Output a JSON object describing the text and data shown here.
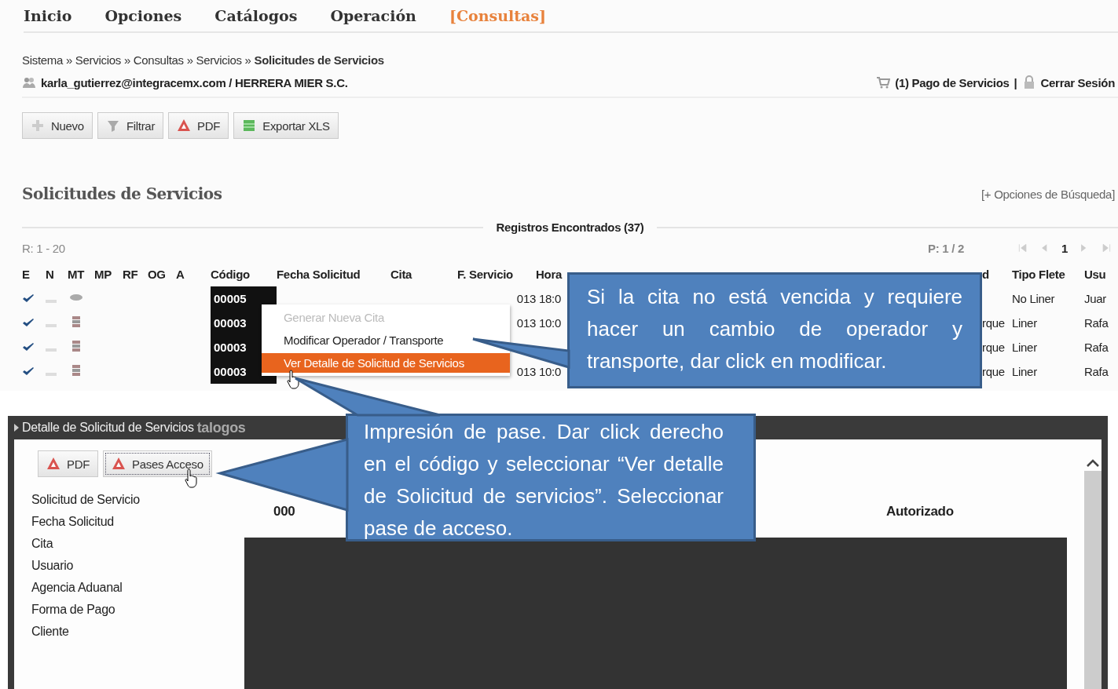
{
  "nav": [
    {
      "label": "Inicio",
      "selected": false
    },
    {
      "label": "Opciones",
      "selected": false
    },
    {
      "label": "Catálogos",
      "selected": false
    },
    {
      "label": "Operación",
      "selected": false
    },
    {
      "label": "[Consultas]",
      "selected": true
    }
  ],
  "breadcrumb": {
    "path": "Sistema » Servicios » Consultas » Servicios » ",
    "current": "Solicitudes de Servicios"
  },
  "user": "karla_gutierrez@integracemx.com / HERRERA MIER S.C.",
  "cart_link": "(1) Pago de Servicios",
  "separator": "|",
  "logout": "Cerrar Sesión",
  "toolbar": [
    {
      "kind": "new",
      "label": "Nuevo"
    },
    {
      "kind": "filter",
      "label": "Filtrar"
    },
    {
      "kind": "pdf",
      "label": "PDF"
    },
    {
      "kind": "xls",
      "label": "Exportar XLS"
    }
  ],
  "section_title": "Solicitudes de Servicios",
  "search_options": "[+ Opciones de Búsqueda]",
  "records": "Registros Encontrados (37)",
  "range": "R: 1 - 20",
  "pages": "P: 1 / 2",
  "page_number": "1",
  "table": {
    "columns": [
      "E",
      "N",
      "MT",
      "MP",
      "RF",
      "OG",
      "A",
      "Código",
      "Fecha Solicitud",
      "Cita",
      "F. Servicio",
      "Hora",
      "d",
      "Tipo Flete",
      "Usu"
    ],
    "rows": [
      {
        "approved": true,
        "kind": "disk",
        "codigo": "00005",
        "f_servicio": "013",
        "hora": "18:0",
        "tipo_flete": "No Liner",
        "usuario": "Juar"
      },
      {
        "approved": true,
        "kind": "stack",
        "codigo": "00003",
        "f_servicio": "013",
        "hora": "10:0",
        "column_13": "rque",
        "tipo_flete": "Liner",
        "usuario": "Rafa"
      },
      {
        "approved": true,
        "kind": "stack",
        "codigo": "00003",
        "column_13": "rque",
        "tipo_flete": "Liner",
        "usuario": "Rafa"
      },
      {
        "approved": true,
        "kind": "stack",
        "codigo": "00003",
        "f_servicio": "013",
        "hora": "10:0",
        "column_13": "rque",
        "tipo_flete": "Liner",
        "usuario": "Rafa"
      }
    ]
  },
  "context_menu": [
    {
      "label": "Generar Nueva Cita",
      "disabled": true,
      "selected": false
    },
    {
      "label": "Modificar Operador / Transporte",
      "disabled": false,
      "selected": false
    },
    {
      "label": "Ver Detalle de Solicitud de Servicios",
      "disabled": false,
      "selected": true
    }
  ],
  "detail": {
    "title": "Detalle de Solicitud de Servicios",
    "behind_text": "talogos",
    "buttons": [
      {
        "label": "PDF",
        "focused": false
      },
      {
        "label": "Pases Acceso",
        "focused": true
      }
    ],
    "labels": [
      "Solicitud de Servicio",
      "Fecha Solicitud",
      "Cita",
      "Usuario",
      "Agencia Aduanal",
      "Forma de Pago",
      "Cliente"
    ],
    "first_value": "000",
    "right_header": "Autorizado"
  },
  "callouts": [
    "Si la cita no está vencida y requiere hacer un cambio de operador y transporte, dar click en modificar.",
    "Impresión de pase. Dar click derecho en el código y seleccionar  “Ver detalle de Solicitud de servicios”.  Seleccionar pase de acceso."
  ]
}
